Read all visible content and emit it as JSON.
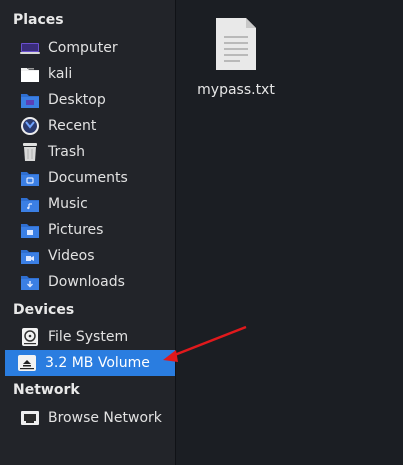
{
  "sidebar": {
    "places_title": "Places",
    "places": [
      {
        "label": "Computer",
        "icon": "computer-icon"
      },
      {
        "label": "kali",
        "icon": "home-folder-icon"
      },
      {
        "label": "Desktop",
        "icon": "desktop-folder-icon"
      },
      {
        "label": "Recent",
        "icon": "recent-icon"
      },
      {
        "label": "Trash",
        "icon": "trash-icon"
      },
      {
        "label": "Documents",
        "icon": "documents-folder-icon"
      },
      {
        "label": "Music",
        "icon": "music-folder-icon"
      },
      {
        "label": "Pictures",
        "icon": "pictures-folder-icon"
      },
      {
        "label": "Videos",
        "icon": "videos-folder-icon"
      },
      {
        "label": "Downloads",
        "icon": "downloads-folder-icon"
      }
    ],
    "devices_title": "Devices",
    "devices": [
      {
        "label": "File System",
        "icon": "hard-drive-icon"
      },
      {
        "label": "3.2 MB Volume",
        "icon": "removable-drive-icon",
        "selected": true
      }
    ],
    "network_title": "Network",
    "network": [
      {
        "label": "Browse Network",
        "icon": "network-icon"
      }
    ]
  },
  "content": {
    "files": [
      {
        "name": "mypass.txt",
        "icon": "text-file-icon"
      }
    ]
  },
  "colors": {
    "selection": "#2a7de0",
    "folder": "#2f6fd1",
    "annotation_arrow": "#e0191c"
  }
}
